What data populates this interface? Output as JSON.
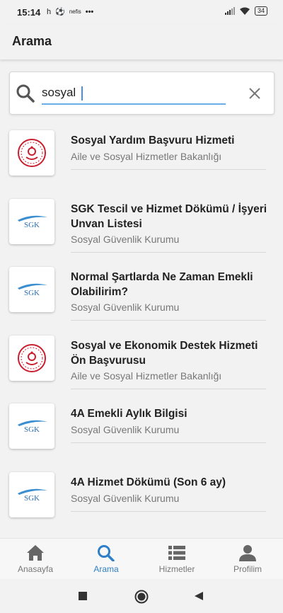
{
  "status_bar": {
    "time": "15:14",
    "icons": [
      "h",
      "⚽",
      "nefis",
      "•••"
    ],
    "battery": "34"
  },
  "header": {
    "title": "Arama"
  },
  "search": {
    "value": "sosyal"
  },
  "results": [
    {
      "title": "Sosyal Yardım Başvuru Hizmeti",
      "subtitle": "Aile ve Sosyal Hizmetler Bakanlığı",
      "logo": "ministry-logo"
    },
    {
      "title": "SGK Tescil ve Hizmet Dökümü / İşyeri Unvan Listesi",
      "subtitle": "Sosyal Güvenlik Kurumu",
      "logo": "SGK"
    },
    {
      "title": "Normal Şartlarda Ne Zaman Emekli Olabilirim?",
      "subtitle": "Sosyal Güvenlik Kurumu",
      "logo": "SGK"
    },
    {
      "title": " Sosyal ve Ekonomik Destek Hizmeti Ön Başvurusu",
      "subtitle": "Aile ve Sosyal Hizmetler Bakanlığı",
      "logo": "ministry-logo"
    },
    {
      "title": "4A Emekli Aylık Bilgisi",
      "subtitle": "Sosyal Güvenlik Kurumu",
      "logo": "SGK"
    },
    {
      "title": "4A Hizmet Dökümü (Son 6 ay)",
      "subtitle": "Sosyal Güvenlik Kurumu",
      "logo": "SGK"
    }
  ],
  "bottom_nav": [
    {
      "label": "Anasayfa",
      "icon": "home-icon"
    },
    {
      "label": "Arama",
      "icon": "search-icon",
      "active": true
    },
    {
      "label": "Hizmetler",
      "icon": "list-icon"
    },
    {
      "label": "Profilim",
      "icon": "person-icon"
    }
  ],
  "colors": {
    "accent": "#2f7fc8",
    "ministry_red": "#c8202f",
    "sgk_blue": "#2a7fc0"
  }
}
